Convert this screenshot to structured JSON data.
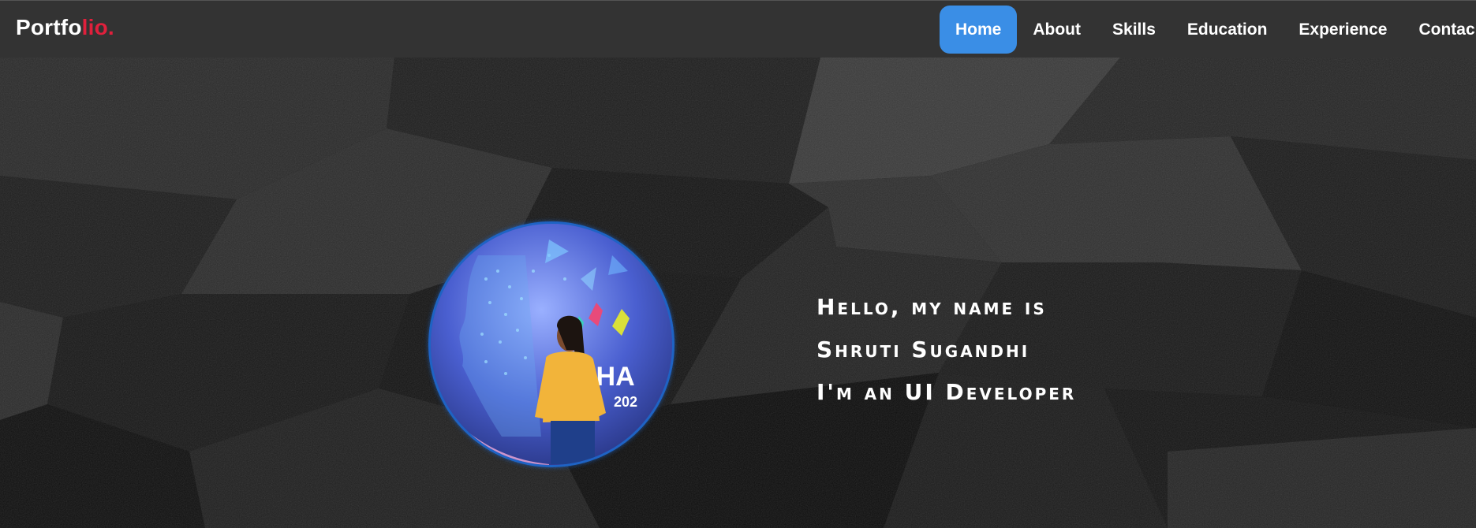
{
  "navbar": {
    "brand_main": "Portfo",
    "brand_accent": "lio.",
    "active_color": "#3a8ee6",
    "accent_color": "#e0203c",
    "links": [
      {
        "label": "Home",
        "active": true
      },
      {
        "label": "About"
      },
      {
        "label": "Skills"
      },
      {
        "label": "Education"
      },
      {
        "label": "Experience"
      },
      {
        "label": "Contac"
      }
    ]
  },
  "hero": {
    "greeting": "Hello, my name is",
    "name": "Shruti Sugandhi",
    "role": "I'm an UI Developer",
    "photo_icon": "profile-photo"
  }
}
